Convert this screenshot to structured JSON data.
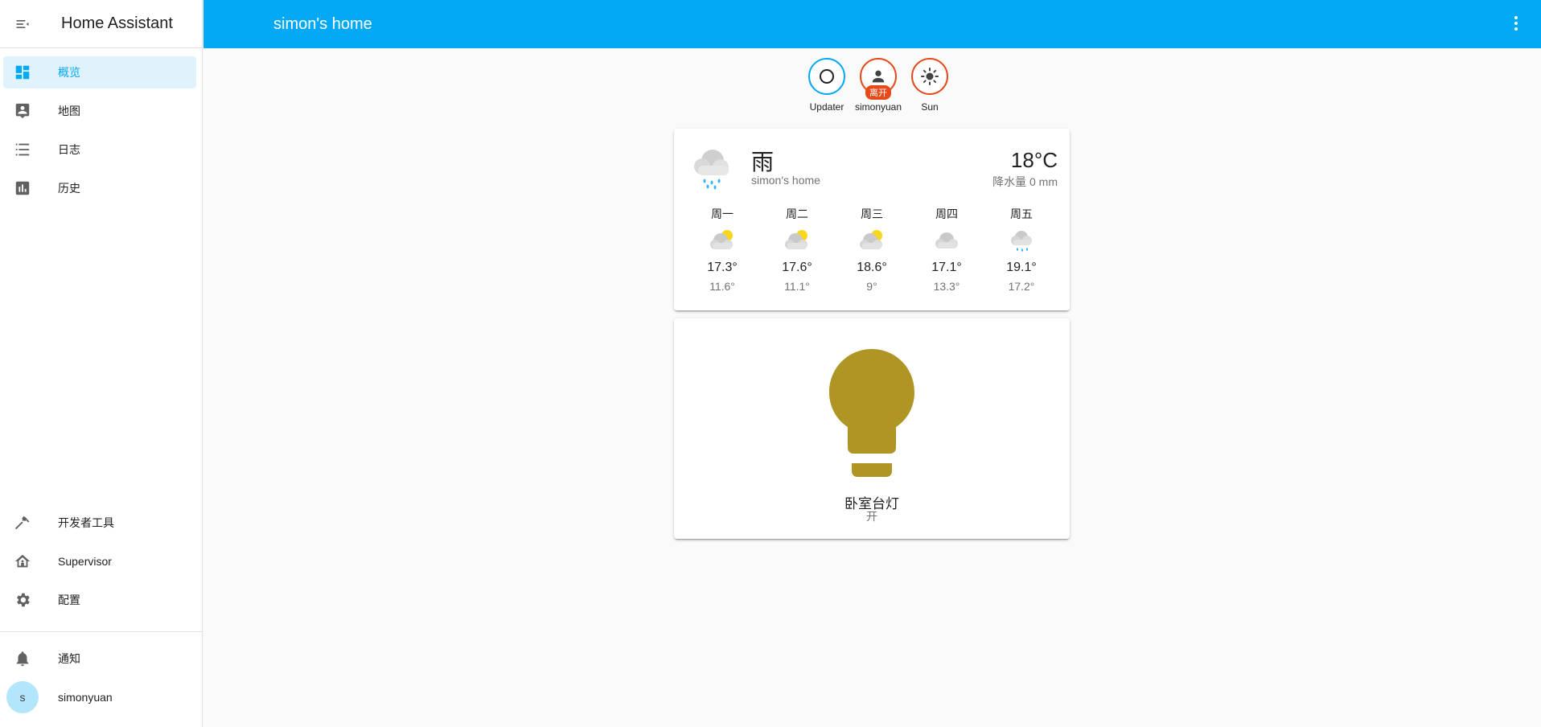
{
  "sidebar": {
    "title": "Home Assistant",
    "items": [
      {
        "label": "概览",
        "icon": "dashboard-icon"
      },
      {
        "label": "地图",
        "icon": "map-icon"
      },
      {
        "label": "日志",
        "icon": "logbook-icon"
      },
      {
        "label": "历史",
        "icon": "history-chart-icon"
      }
    ],
    "bottom_items": [
      {
        "label": "开发者工具",
        "icon": "hammer-icon"
      },
      {
        "label": "Supervisor",
        "icon": "supervisor-icon"
      },
      {
        "label": "配置",
        "icon": "gear-icon"
      }
    ],
    "notifications_label": "通知",
    "user": {
      "name": "simonyuan",
      "initial": "s"
    }
  },
  "header": {
    "title": "simon's home"
  },
  "badges": [
    {
      "label": "Updater",
      "icon": "circle-outline-icon"
    },
    {
      "label": "simonyuan",
      "icon": "person-icon",
      "state": "离开"
    },
    {
      "label": "Sun",
      "icon": "sun-icon"
    }
  ],
  "weather": {
    "condition": "雨",
    "location": "simon's home",
    "temperature": "18°C",
    "precipitation": "降水量 0 mm",
    "forecast": [
      {
        "day": "周一",
        "high": "17.3°",
        "low": "11.6°",
        "icon": "partly-cloudy-icon"
      },
      {
        "day": "周二",
        "high": "17.6°",
        "low": "11.1°",
        "icon": "partly-cloudy-icon"
      },
      {
        "day": "周三",
        "high": "18.6°",
        "low": "9°",
        "icon": "partly-cloudy-icon"
      },
      {
        "day": "周四",
        "high": "17.1°",
        "low": "13.3°",
        "icon": "cloudy-icon"
      },
      {
        "day": "周五",
        "high": "19.1°",
        "low": "17.2°",
        "icon": "rainy-icon"
      }
    ]
  },
  "light": {
    "name": "卧室台灯",
    "state": "开",
    "color": "#ae9524"
  },
  "colors": {
    "primary": "#03a9f4",
    "accent": "#e64a19"
  }
}
